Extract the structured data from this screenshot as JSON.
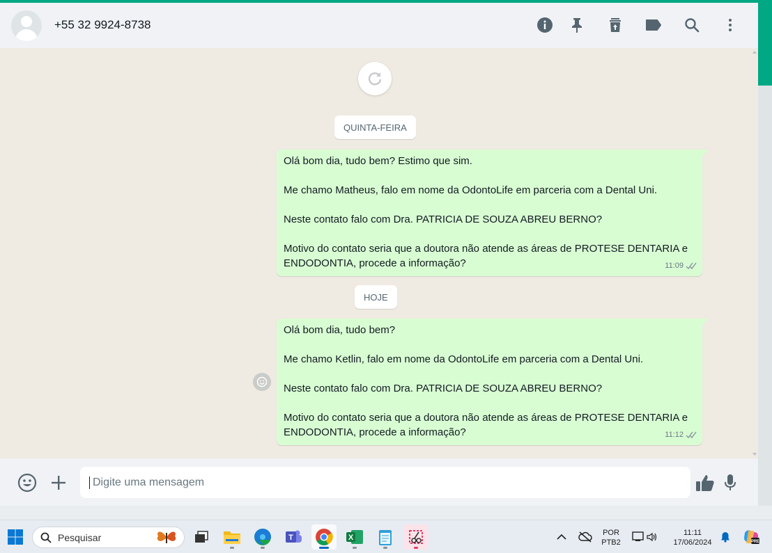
{
  "header": {
    "contact_name": "+55 32 9924-8738",
    "icons": [
      "info-icon",
      "pin-icon",
      "archive-icon",
      "label-icon",
      "search-icon",
      "menu-icon"
    ]
  },
  "chat": {
    "date_chips": [
      "QUINTA-FEIRA",
      "HOJE"
    ],
    "messages": [
      {
        "text": "Olá bom dia, tudo bem? Estimo que sim.\n\nMe chamo Matheus, falo em nome da OdontoLife em parceria com a Dental Uni.\n\nNeste contato falo com Dra. PATRICIA DE SOUZA ABREU BERNO?\n\nMotivo do contato seria que a doutora não atende as áreas de PROTESE DENTARIA e ENDODONTIA, procede a informação?",
        "time": "11:09",
        "status": "read"
      },
      {
        "text": "Olá bom dia, tudo bem?\n\nMe chamo Ketlin, falo em nome da OdontoLife em parceria com a Dental Uni.\n\nNeste contato falo com Dra. PATRICIA DE SOUZA ABREU BERNO?\n\nMotivo do contato seria que a doutora não atende as áreas de PROTESE DENTARIA e ENDODONTIA, procede a informação?",
        "time": "11:12",
        "status": "read"
      }
    ]
  },
  "composer": {
    "placeholder": "Digite uma mensagem",
    "value": ""
  },
  "taskbar": {
    "search_label": "Pesquisar",
    "language": "POR",
    "keyboard": "PTB2",
    "time": "11:11",
    "date": "17/06/2024",
    "apps": [
      "file-explorer",
      "edge",
      "teams",
      "chrome",
      "excel",
      "notepad",
      "snipping-tool"
    ]
  },
  "colors": {
    "accent": "#00a884",
    "bubble_out": "#d9fdd3",
    "chat_bg": "#efeae2",
    "panel": "#f0f2f5",
    "icon": "#54656f",
    "read_ticks": "#8696a0"
  }
}
